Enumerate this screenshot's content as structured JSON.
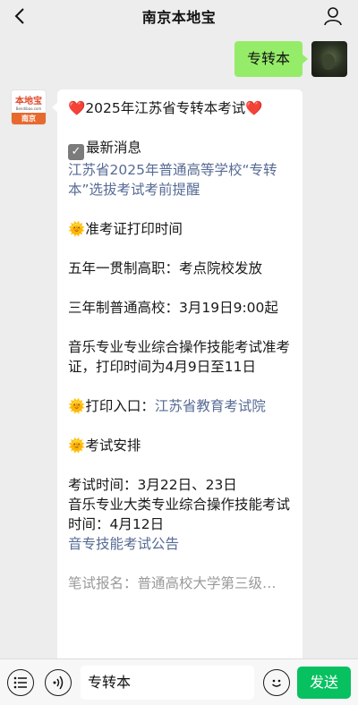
{
  "header": {
    "title": "南京本地宝"
  },
  "outgoing": {
    "text": "专转本"
  },
  "bot": {
    "logo_brand": "本地宝",
    "logo_domain": "Bendibao.com",
    "logo_city": "南京"
  },
  "message": {
    "headline_heart_left": "❤️",
    "headline": "2025年江苏省专转本考试",
    "headline_heart_right": "❤️",
    "latest_label": "最新消息",
    "latest_link": "江苏省2025年普通高等学校“专转本”选拔考试考前提醒",
    "sun": "🌞",
    "admission_label": "准考证打印时间",
    "five_year": "五年一贯制高职：考点院校发放",
    "three_year": "三年制普通高校：3月19日9:00起",
    "music_admission": "音乐专业专业综合操作技能考试准考证，打印时间为4月9日至11日",
    "print_entry_label": "打印入口：",
    "print_entry_link": "江苏省教育考试院",
    "schedule_label": "考试安排",
    "exam_time": "考试时间：3月22日、23日",
    "music_exam_time": "音乐专业大类专业综合操作技能考试时间：4月12日",
    "music_notice_link": "音专技能考试公告",
    "cut_line": "笔试报名：普通高校大学第三级…"
  },
  "composer": {
    "input_value": "专转本",
    "send_label": "发送"
  }
}
